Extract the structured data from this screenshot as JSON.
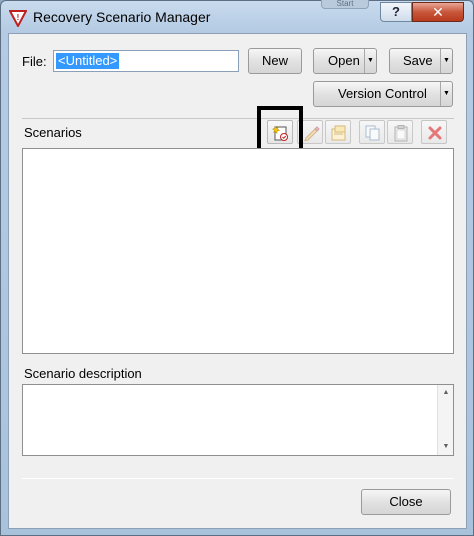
{
  "window": {
    "title": "Recovery Scenario Manager",
    "ghost_button": "Start",
    "help_glyph": "?",
    "close_glyph": "✕"
  },
  "file": {
    "label": "File:",
    "value": "<Untitled>"
  },
  "buttons": {
    "new": "New",
    "open": "Open",
    "save": "Save",
    "version_control": "Version Control",
    "close": "Close"
  },
  "scenarios": {
    "label": "Scenarios",
    "items": []
  },
  "toolbar": {
    "icons": [
      "new-scenario-icon",
      "edit-scenario-icon",
      "properties-icon",
      "copy-icon",
      "paste-icon",
      "delete-icon"
    ]
  },
  "description": {
    "label": "Scenario description",
    "value": ""
  },
  "colors": {
    "accent": "#3399ff",
    "close_button": "#c8573c",
    "delete_icon": "#d02020"
  }
}
